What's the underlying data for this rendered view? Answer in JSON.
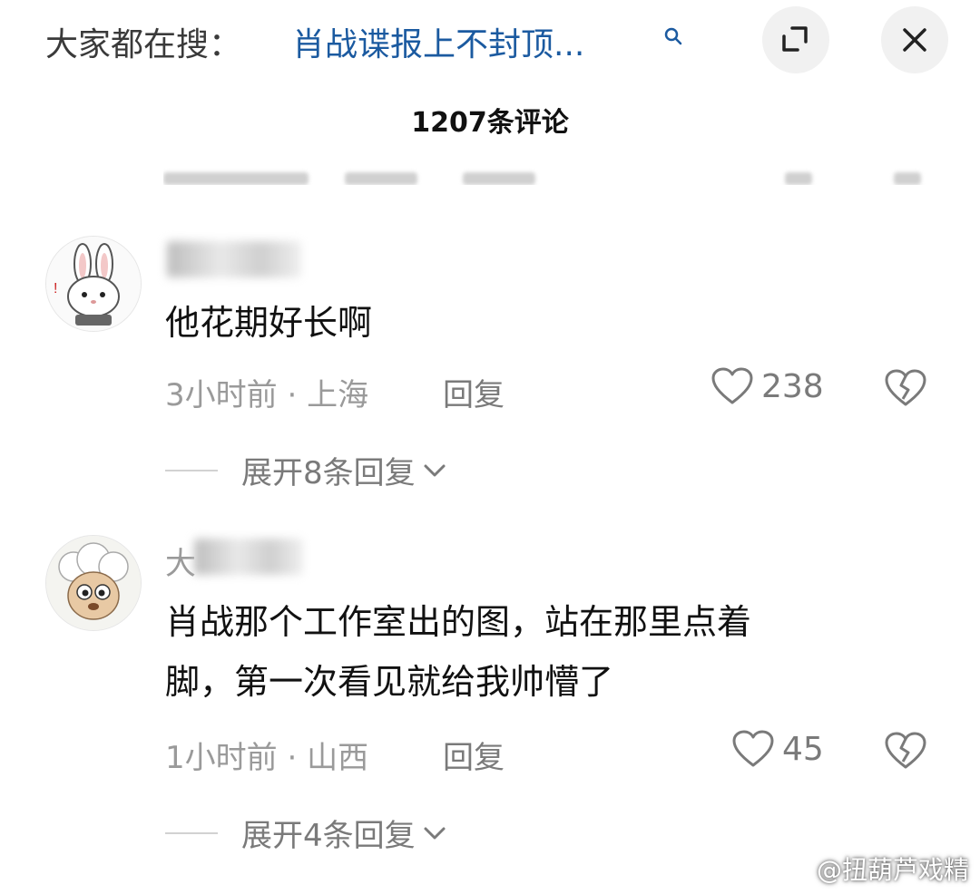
{
  "header": {
    "search_prefix": "大家都在搜：",
    "search_query": "肖战谍报上不封顶...",
    "comment_count": "1207条评论"
  },
  "comments": [
    {
      "avatar_icon": "bunny-avatar-icon",
      "text": "他花期好长啊",
      "time": "3小时前",
      "location": "上海",
      "reply_label": "回复",
      "likes": "238",
      "expand_label": "展开8条回复"
    },
    {
      "avatar_icon": "sheep-avatar-icon",
      "username_visible": "大",
      "text_line1": "肖战那个工作室出的图，站在那里点着",
      "text_line2": "脚，第一次看见就给我帅懵了",
      "time": "1小时前",
      "location": "山西",
      "reply_label": "回复",
      "likes": "45",
      "expand_label": "展开4条回复"
    }
  ],
  "watermark": "@扭葫芦戏精",
  "colors": {
    "search_query": "#1b5aa0",
    "meta_gray": "#9a9a9a",
    "icon_gray": "#7a7a7a"
  }
}
